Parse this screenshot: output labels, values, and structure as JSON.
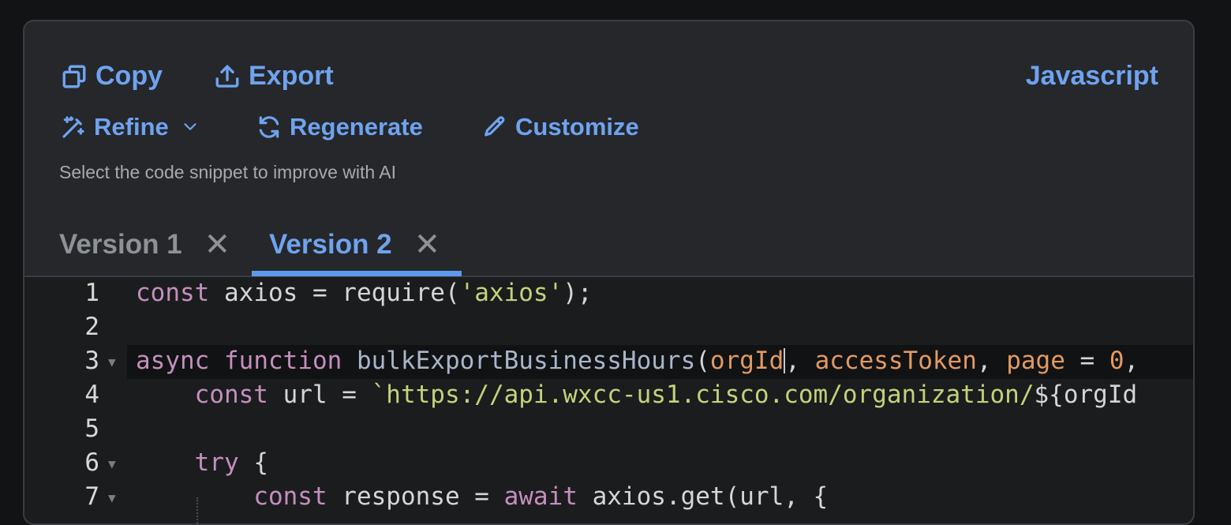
{
  "toolbar": {
    "copy_label": "Copy",
    "export_label": "Export",
    "language": "Javascript",
    "refine_label": "Refine",
    "regenerate_label": "Regenerate",
    "customize_label": "Customize",
    "hint": "Select the code snippet to improve with AI"
  },
  "tabs": [
    {
      "label": "Version 1",
      "active": false
    },
    {
      "label": "Version 2",
      "active": true
    }
  ],
  "code": {
    "line_numbers": [
      "1",
      "2",
      "3",
      "4",
      "5",
      "6",
      "7"
    ],
    "line1": {
      "kw": "const",
      "rest1": " axios = require(",
      "str": "'axios'",
      "rest2": ");"
    },
    "line3": {
      "kw1": "async",
      "kw2": "function",
      "fn": "bulkExportBusinessHours",
      "open": "(",
      "p1": "orgId",
      "sep1": ", ",
      "p2": "accessToken",
      "sep2": ", ",
      "p3": "page",
      "eq": " = ",
      "num": "0",
      "tail": ","
    },
    "line4": {
      "kw": "const",
      "mid": " url = ",
      "str": "`https://api.wxcc-us1.cisco.com/organization/",
      "tpl": "${orgId"
    },
    "line6": {
      "kw": "try",
      "rest": " {"
    },
    "line7": {
      "kw": "const",
      "mid": " response = ",
      "kw2": "await",
      "rest": " axios.get(url, {"
    }
  },
  "colors": {
    "accent": "#6fa3ef",
    "panel": "#25272b",
    "editor": "#1b1c1e"
  }
}
